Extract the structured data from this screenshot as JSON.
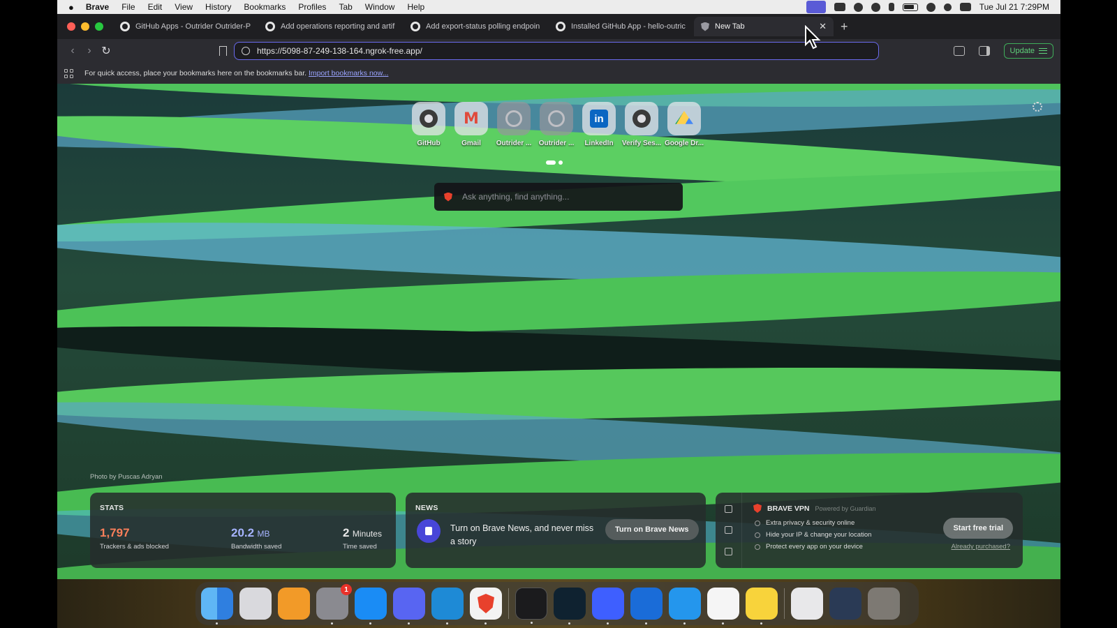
{
  "menubar": {
    "app_name": "Brave",
    "items": [
      "File",
      "Edit",
      "View",
      "History",
      "Bookmarks",
      "Profiles",
      "Tab",
      "Window",
      "Help"
    ],
    "clock": "Tue Jul 21  7:29PM"
  },
  "tabs": [
    {
      "title": "GitHub Apps - Outrider Outrider-P",
      "icon": "github-icon"
    },
    {
      "title": "Add operations reporting and artif",
      "icon": "github-icon"
    },
    {
      "title": "Add export-status polling endpoin",
      "icon": "github-icon"
    },
    {
      "title": "Installed GitHub App - hello-outric",
      "icon": "github-icon"
    },
    {
      "title": "New Tab",
      "icon": "brave-shield-icon",
      "active": true
    }
  ],
  "toolbar": {
    "url": "https://5098-87-249-138-164.ngrok-free.app/",
    "update_label": "Update"
  },
  "bookmarks_bar": {
    "message": "For quick access, place your bookmarks here on the bookmarks bar.",
    "import_link": "Import bookmarks now..."
  },
  "new_tab": {
    "top_sites": [
      {
        "label": "GitHub",
        "icon": "github-icon"
      },
      {
        "label": "Gmail",
        "icon": "gmail-icon"
      },
      {
        "label": "Outrider ...",
        "icon": "globe-icon"
      },
      {
        "label": "Outrider ...",
        "icon": "globe-icon"
      },
      {
        "label": "LinkedIn",
        "icon": "linkedin-icon"
      },
      {
        "label": "Verify Ses...",
        "icon": "github-icon"
      },
      {
        "label": "Google Dr...",
        "icon": "google-drive-icon"
      }
    ],
    "search_placeholder": "Ask anything, find anything...",
    "photo_credit": "Photo by Puscas Adryan",
    "stats": {
      "heading": "STATS",
      "trackers_value": "1,797",
      "trackers_label": "Trackers & ads blocked",
      "bandwidth_value": "20.2",
      "bandwidth_unit": "MB",
      "bandwidth_label": "Bandwidth saved",
      "time_value": "2",
      "time_unit": "Minutes",
      "time_label": "Time saved"
    },
    "news": {
      "heading": "NEWS",
      "text": "Turn on Brave News, and never miss a story",
      "button": "Turn on Brave News"
    },
    "vpn": {
      "title": "BRAVE VPN",
      "powered_by": "Powered by  Guardian",
      "features": [
        "Extra privacy & security online",
        "Hide your IP & change your location",
        "Protect every app on your device"
      ],
      "button": "Start free trial",
      "link": "Already purchased?"
    }
  },
  "dock": {
    "apps": [
      "finder",
      "launchpad",
      "pages",
      "system-settings",
      "app-store",
      "discord",
      "vscode",
      "brave",
      "terminal",
      "cursor",
      "nordvpn",
      "1password",
      "docker",
      "slack",
      "notes",
      "file",
      "screenshot",
      "trash"
    ],
    "settings_badge": "1"
  },
  "colors": {
    "accent": "#6b6bf0",
    "update_green": "#3fae5a",
    "trackers_red": "#fb7f5a",
    "bandwidth_blue": "#a6b4ff"
  }
}
